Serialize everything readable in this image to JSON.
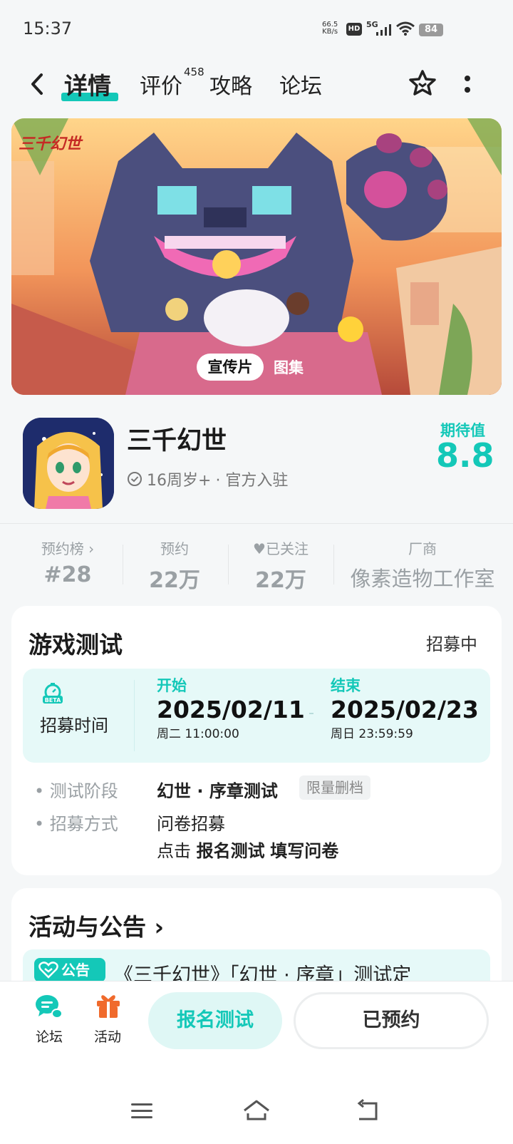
{
  "status_bar": {
    "time": "15:37",
    "net_speed_value": "66.5",
    "net_speed_unit": "KB/s",
    "hd": "HD",
    "signal": "5G",
    "battery": "84"
  },
  "nav": {
    "tabs": [
      {
        "label": "详情",
        "active": true
      },
      {
        "label": "评价",
        "badge": "458"
      },
      {
        "label": "攻略"
      },
      {
        "label": "论坛"
      }
    ]
  },
  "banner": {
    "logo_text": "三千幻世",
    "video_label": "宣传片",
    "gallery_label": "图集"
  },
  "app": {
    "name": "三千幻世",
    "age_rating": "16周岁+",
    "official": "· 官方入驻",
    "expectation_label": "期待值",
    "expectation_value": "8.8"
  },
  "stats": [
    {
      "label": "预约榜 ›",
      "value": "#28"
    },
    {
      "label": "预约",
      "value": "22万"
    },
    {
      "label": "已关注",
      "value": "22万"
    },
    {
      "label": "厂商",
      "value": "像素造物工作室"
    }
  ],
  "test": {
    "title": "游戏测试",
    "status": "招募中",
    "recruit_time_label": "招募时间",
    "start_label": "开始",
    "start_date": "2025/02/11",
    "start_sub": "周二  11:00:00",
    "end_label": "结束",
    "end_date": "2025/02/23",
    "end_sub": "周日  23:59:59",
    "stage_label": "测试阶段",
    "stage_value": "幻世 · 序章测试",
    "stage_tag": "限量删档",
    "method_label": "招募方式",
    "method_value": "问卷招募",
    "method_action_prefix": "点击",
    "method_action_1": "报名测试",
    "method_action_2": "填写问卷"
  },
  "activity": {
    "title": "活动与公告 ›",
    "notice_badge": "公告",
    "notice_text": "《三千幻世》「幻世 · 序章」测试定"
  },
  "bottom": {
    "forum_label": "论坛",
    "activity_label": "活动",
    "signup_button": "报名测试",
    "reserved_button": "已预约"
  },
  "colors": {
    "accent": "#14c8b8",
    "gift": "#f06a2c"
  }
}
